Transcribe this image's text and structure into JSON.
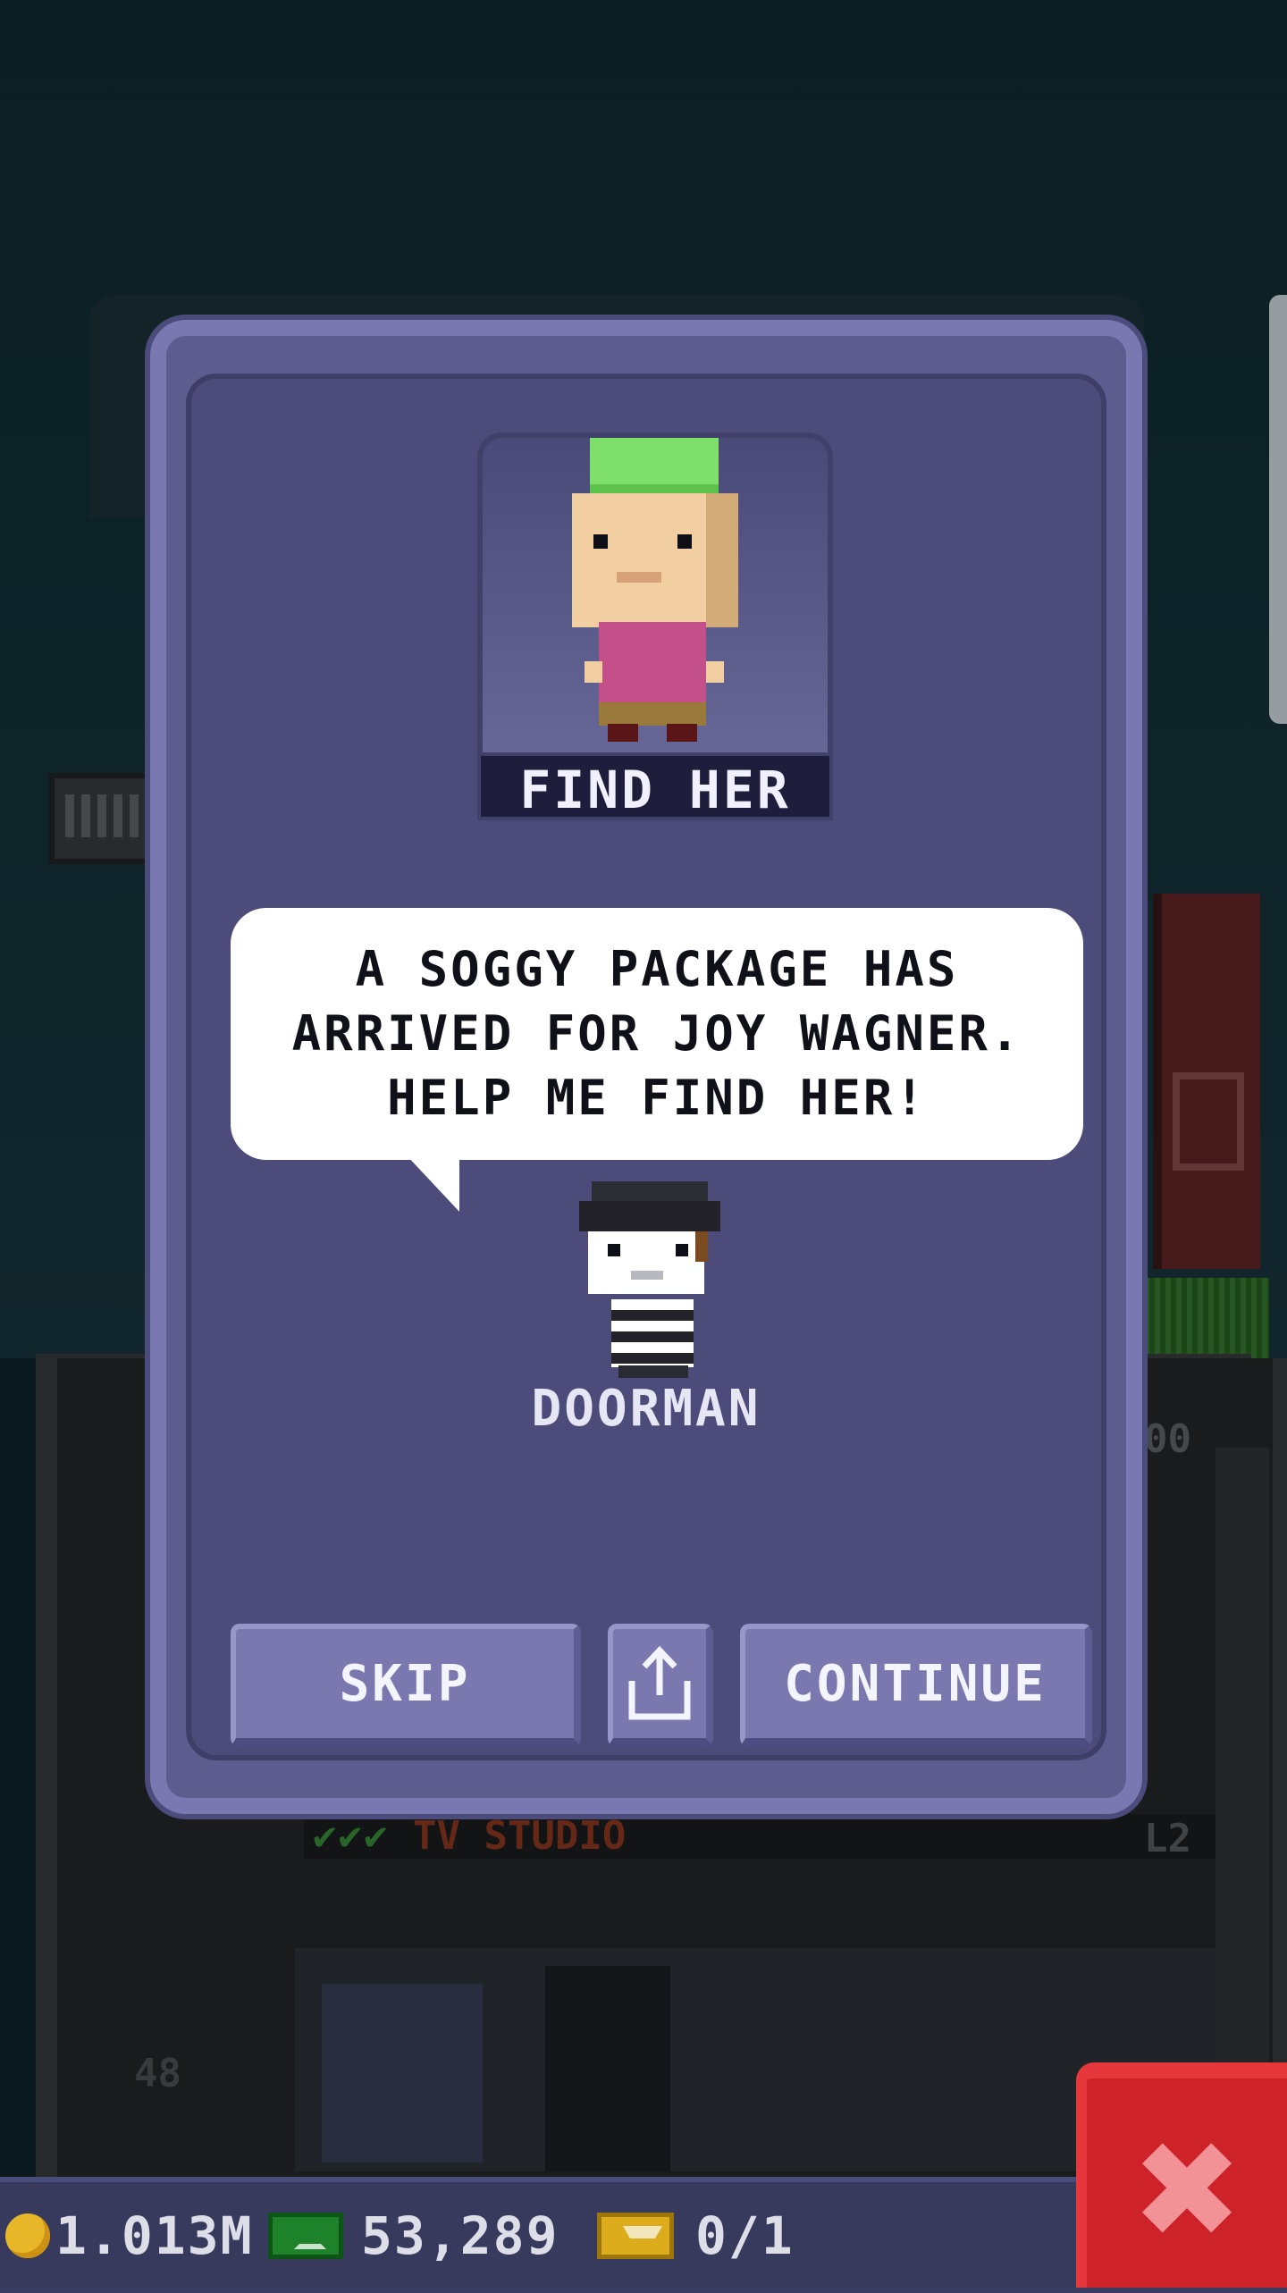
{
  "background": {
    "floor_label": "TV STUDIO",
    "floor_checks": "✔✔✔",
    "floor_level": "L2",
    "floor_number_left": "48",
    "ghost_number": "00"
  },
  "dialog": {
    "portrait_label": "FIND HER",
    "message": "A SOGGY PACKAGE HAS ARRIVED FOR JOY WAGNER. HELP ME FIND HER!",
    "npc_name": "DOORMAN",
    "buttons": {
      "skip": "SKIP",
      "share_icon": "share-icon",
      "continue": "CONTINUE"
    }
  },
  "hud": {
    "coins": "1.013M",
    "bux": "53,289",
    "tickets": "0/1",
    "close_icon": "close-icon"
  },
  "colors": {
    "dialog_bg": "#4c4b7a",
    "dialog_border": "#7a78b0",
    "button": "#7a78ae",
    "close_button": "#d9242a",
    "coin": "#f4c12c",
    "cash": "#1f8a2c",
    "ticket": "#e8b61e"
  }
}
